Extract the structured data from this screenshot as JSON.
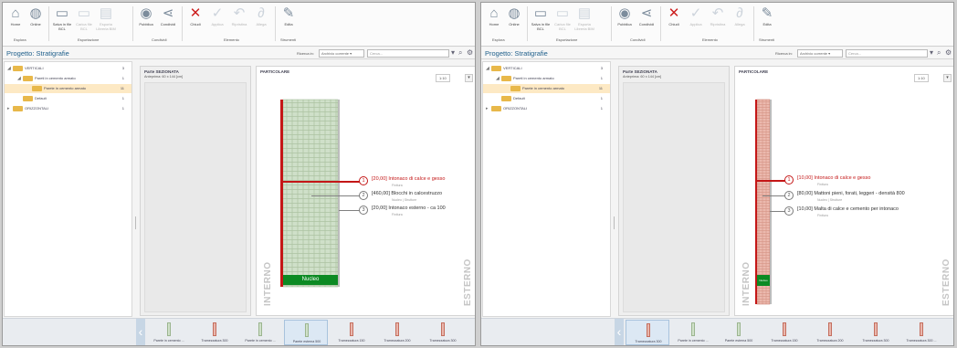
{
  "panels": [
    {
      "ribbon": {
        "buttons": [
          {
            "label": "Home",
            "icon": "home-icon"
          },
          {
            "label": "Online",
            "icon": "globe-icon"
          },
          {
            "label": "Salva in file BCL",
            "icon": "save-icon"
          },
          {
            "label": "Carica file BCL",
            "icon": "upload-icon"
          },
          {
            "label": "Esporta Libreria BIM",
            "icon": "export-icon"
          },
          {
            "label": "Pubblica",
            "icon": "publish-icon"
          },
          {
            "label": "Condividi",
            "icon": "share-icon"
          },
          {
            "label": "Chiudi",
            "icon": "close-icon"
          },
          {
            "label": "Applica",
            "icon": "check-icon"
          },
          {
            "label": "Ripristina",
            "icon": "undo-icon"
          },
          {
            "label": "Allega",
            "icon": "paperclip-icon"
          },
          {
            "label": "Edita",
            "icon": "edit-icon"
          }
        ],
        "groups": {
          "esplora": "Esplora",
          "esportazione": "Esportazione",
          "condividi": "Condividi",
          "elemento": "Elemento",
          "strumenti": "Strumenti"
        }
      },
      "project_title": "Progetto: Stratigrafie",
      "search": {
        "label": "Ricerca in:",
        "scope": "Archivio corrente",
        "placeholder": "Cerca..."
      },
      "tree": [
        {
          "label": "VERTICALI",
          "count": "3"
        },
        {
          "label": "Pareti in cemento armato",
          "count": "1"
        },
        {
          "label": "Parete in cemento armato",
          "count": "11"
        },
        {
          "label": "Default",
          "count": "1"
        },
        {
          "label": "ORIZZONTALI",
          "count": "1"
        }
      ],
      "sezionata": {
        "title": "Parte SEZIONATA",
        "subtitle": "Anteprima: 60 x 144 [cm]"
      },
      "particolare": {
        "title": "PARTICOLARE",
        "scale": "1:10",
        "internal": "INTERNO",
        "external": "ESTERNO",
        "nucleo": "Nucleo",
        "layers": [
          {
            "num": "1",
            "thickness": "[20,00]",
            "name": "Intonaco di calce e gesso",
            "sub": "Finitura"
          },
          {
            "num": "2",
            "thickness": "[460,00]",
            "name": "Blocchi in calcestruzzo",
            "sub": "Nucleo  |  Strutture"
          },
          {
            "num": "3",
            "thickness": "[20,00]",
            "name": "Intonaco esterno - ca 100",
            "sub": "Finitura"
          }
        ]
      },
      "carousel": [
        {
          "name": "Parete in cemento ..."
        },
        {
          "name": "Tramezzatura 300"
        },
        {
          "name": "Parete in cemento ..."
        },
        {
          "name": "Parete esterna 500"
        },
        {
          "name": "Tramezzatura 150"
        },
        {
          "name": "Tramezzatura 200"
        },
        {
          "name": "Tramezzatura 300"
        }
      ]
    },
    {
      "ribbon": {
        "buttons": [
          {
            "label": "Home",
            "icon": "home-icon"
          },
          {
            "label": "Online",
            "icon": "globe-icon"
          },
          {
            "label": "Salva in file BCL",
            "icon": "save-icon"
          },
          {
            "label": "Carica file BCL",
            "icon": "upload-icon"
          },
          {
            "label": "Esporta Libreria BIM",
            "icon": "export-icon"
          },
          {
            "label": "Pubblica",
            "icon": "publish-icon"
          },
          {
            "label": "Condividi",
            "icon": "share-icon"
          },
          {
            "label": "Chiudi",
            "icon": "close-icon"
          },
          {
            "label": "Applica",
            "icon": "check-icon"
          },
          {
            "label": "Ripristina",
            "icon": "undo-icon"
          },
          {
            "label": "Allega",
            "icon": "paperclip-icon"
          },
          {
            "label": "Edita",
            "icon": "edit-icon"
          }
        ],
        "groups": {
          "esplora": "Esplora",
          "esportazione": "Esportazione",
          "condividi": "Condividi",
          "elemento": "Elemento",
          "strumenti": "Strumenti"
        }
      },
      "project_title": "Progetto: Stratigrafie",
      "search": {
        "label": "Ricerca in:",
        "scope": "Archivio corrente",
        "placeholder": "Cerca..."
      },
      "tree": [
        {
          "label": "VERTICALI",
          "count": "3"
        },
        {
          "label": "Pareti in cemento armato",
          "count": "1"
        },
        {
          "label": "Parete in cemento armato",
          "count": "11"
        },
        {
          "label": "Default",
          "count": "1"
        },
        {
          "label": "ORIZZONTALI",
          "count": "1"
        }
      ],
      "sezionata": {
        "title": "Parte SEZIONATA",
        "subtitle": "Anteprima: 60 x 144 [cm]"
      },
      "particolare": {
        "title": "PARTICOLARE",
        "scale": "1:10",
        "internal": "INTERNO",
        "external": "ESTERNO",
        "nucleo": "Nucleo",
        "layers": [
          {
            "num": "1",
            "thickness": "[10,00]",
            "name": "Intonaco di calce e gesso",
            "sub": "Finitura"
          },
          {
            "num": "2",
            "thickness": "[80,00]",
            "name": "Mattoni pieni, forati, leggeri - densità 800",
            "sub": "Nucleo  |  Strutture"
          },
          {
            "num": "3",
            "thickness": "[10,00]",
            "name": "Malta di calce e cemento per intonaco",
            "sub": "Finitura"
          }
        ]
      },
      "carousel": [
        {
          "name": "Tramezzatura 300"
        },
        {
          "name": "Parete in cemento ..."
        },
        {
          "name": "Parete esterna 500"
        },
        {
          "name": "Tramezzatura 150"
        },
        {
          "name": "Tramezzatura 200"
        },
        {
          "name": "Tramezzatura 300"
        },
        {
          "name": "Tramezzatura 300 ..."
        }
      ]
    }
  ],
  "colors": {
    "accent": "#1f5f8b",
    "highlight_layer": "#c41616",
    "nucleo": "#0c8a23",
    "selection": "#fde9c4"
  }
}
